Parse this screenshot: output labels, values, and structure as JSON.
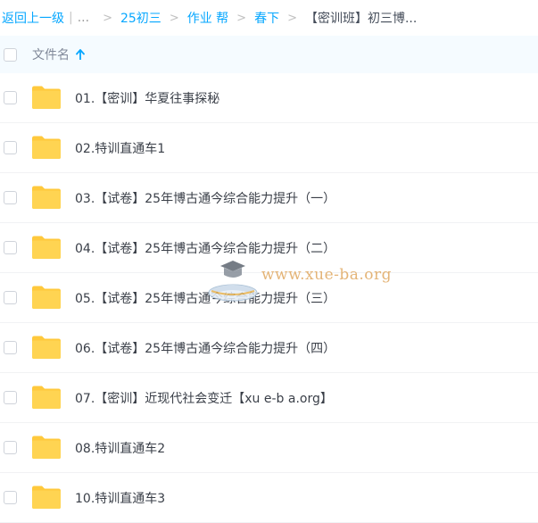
{
  "breadcrumb": {
    "back": "返回上一级",
    "ellipsis": "...",
    "items": [
      "25初三",
      "作业 帮",
      "春下"
    ],
    "current": "【密训班】初三博..."
  },
  "header": {
    "column_label": "文件名"
  },
  "files": [
    {
      "name": "01.【密训】华夏往事探秘"
    },
    {
      "name": "02.特训直通车1"
    },
    {
      "name": "03.【试卷】25年博古通今综合能力提升（一）"
    },
    {
      "name": "04.【试卷】25年博古通今综合能力提升（二）"
    },
    {
      "name": "05.【试卷】25年博古通今综合能力提升（三）"
    },
    {
      "name": "06.【试卷】25年博古通今综合能力提升（四）"
    },
    {
      "name": "07.【密训】近现代社会变迁【xu e-b a.org】"
    },
    {
      "name": "08.特训直通车2"
    },
    {
      "name": "10.特训直通车3"
    }
  ],
  "watermark": {
    "text": "www.xue-ba.org"
  },
  "colors": {
    "link": "#06a7ff",
    "folder": "#ffd152",
    "header_bg": "#f5fbff"
  }
}
